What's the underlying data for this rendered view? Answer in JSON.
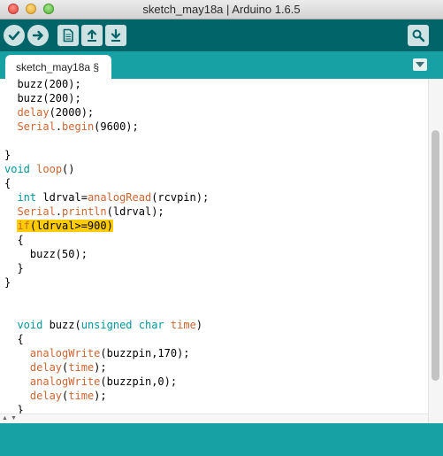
{
  "window": {
    "title": "sketch_may18a | Arduino 1.6.5"
  },
  "toolbar": {
    "buttons": [
      {
        "name": "verify",
        "icon": "check-icon"
      },
      {
        "name": "upload",
        "icon": "arrow-right-icon"
      },
      {
        "name": "new",
        "icon": "document-icon"
      },
      {
        "name": "open",
        "icon": "arrow-up-icon"
      },
      {
        "name": "save",
        "icon": "arrow-down-icon"
      },
      {
        "name": "serial-monitor",
        "icon": "magnifier-icon"
      }
    ]
  },
  "tabs": [
    {
      "label": "sketch_may18a §",
      "active": true
    }
  ],
  "editor": {
    "lines": [
      [
        {
          "t": "  buzz(200);"
        }
      ],
      [
        {
          "t": "  buzz(200);"
        }
      ],
      [
        {
          "t": "  "
        },
        {
          "t": "delay",
          "c": "kw"
        },
        {
          "t": "(2000);"
        }
      ],
      [
        {
          "t": "  "
        },
        {
          "t": "Serial",
          "c": "kw"
        },
        {
          "t": "."
        },
        {
          "t": "begin",
          "c": "kw"
        },
        {
          "t": "(9600);"
        }
      ],
      [
        {
          "t": ""
        }
      ],
      [
        {
          "t": "}"
        }
      ],
      [
        {
          "t": "void",
          "c": "ty"
        },
        {
          "t": " "
        },
        {
          "t": "loop",
          "c": "kw"
        },
        {
          "t": "()"
        }
      ],
      [
        {
          "t": "{"
        }
      ],
      [
        {
          "t": "  "
        },
        {
          "t": "int",
          "c": "ty"
        },
        {
          "t": " ldrval="
        },
        {
          "t": "analogRead",
          "c": "kw"
        },
        {
          "t": "(rcvpin);"
        }
      ],
      [
        {
          "t": "  "
        },
        {
          "t": "Serial",
          "c": "kw"
        },
        {
          "t": "."
        },
        {
          "t": "println",
          "c": "kw"
        },
        {
          "t": "(ldrval);"
        }
      ],
      [
        {
          "t": "  "
        },
        {
          "t": "if",
          "c": "kw hl"
        },
        {
          "t": "(ldrval>=900)",
          "c": "hl"
        }
      ],
      [
        {
          "t": "  {"
        }
      ],
      [
        {
          "t": "    buzz(50);"
        }
      ],
      [
        {
          "t": "  }"
        }
      ],
      [
        {
          "t": "}"
        }
      ],
      [
        {
          "t": ""
        }
      ],
      [
        {
          "t": ""
        }
      ],
      [
        {
          "t": "  "
        },
        {
          "t": "void",
          "c": "ty"
        },
        {
          "t": " buzz("
        },
        {
          "t": "unsigned",
          "c": "ty"
        },
        {
          "t": " "
        },
        {
          "t": "char",
          "c": "ty"
        },
        {
          "t": " "
        },
        {
          "t": "time",
          "c": "kw"
        },
        {
          "t": ")"
        }
      ],
      [
        {
          "t": "  {"
        }
      ],
      [
        {
          "t": "    "
        },
        {
          "t": "analogWrite",
          "c": "kw"
        },
        {
          "t": "(buzzpin,170);"
        }
      ],
      [
        {
          "t": "    "
        },
        {
          "t": "delay",
          "c": "kw"
        },
        {
          "t": "("
        },
        {
          "t": "time",
          "c": "kw"
        },
        {
          "t": ");"
        }
      ],
      [
        {
          "t": "    "
        },
        {
          "t": "analogWrite",
          "c": "kw"
        },
        {
          "t": "(buzzpin,0);"
        }
      ],
      [
        {
          "t": "    "
        },
        {
          "t": "delay",
          "c": "kw"
        },
        {
          "t": "("
        },
        {
          "t": "time",
          "c": "kw"
        },
        {
          "t": ");"
        }
      ],
      [
        {
          "t": "  }"
        }
      ]
    ]
  },
  "scroll": {
    "vertical_position": 0.55,
    "vertical_visible_fraction": 0.74
  },
  "colors": {
    "toolbar": "#006468",
    "tab_strip": "#17a1a5",
    "keyword": "#cc6633",
    "type": "#00979c",
    "highlight": "#ffcc00"
  }
}
